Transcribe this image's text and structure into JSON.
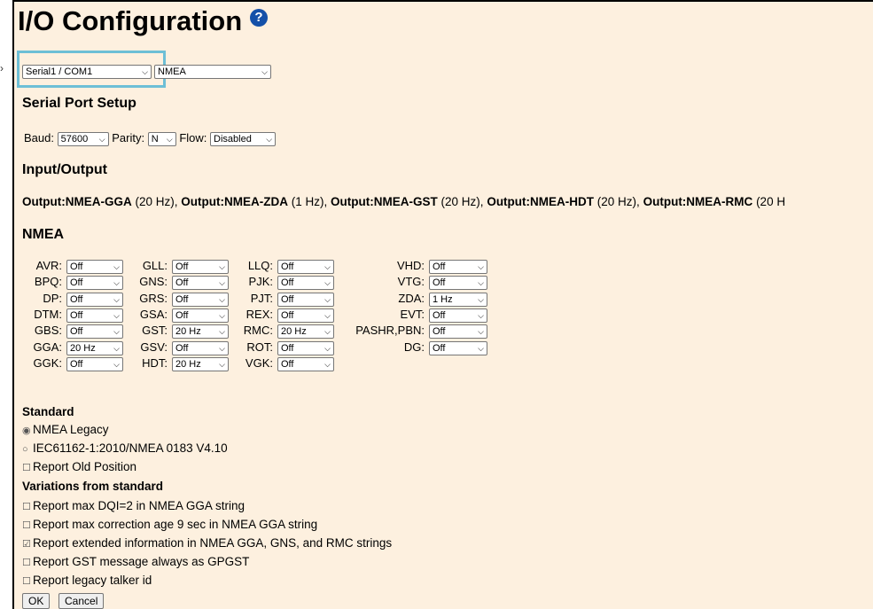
{
  "page": {
    "title": "I/O Configuration"
  },
  "port": {
    "selected": "Serial1 / COM1",
    "protocol": "NMEA"
  },
  "serial": {
    "heading": "Serial Port Setup",
    "baud_label": "Baud:",
    "baud_value": "57600",
    "parity_label": "Parity:",
    "parity_value": "N",
    "flow_label": "Flow:",
    "flow_value": "Disabled"
  },
  "io": {
    "heading": "Input/Output",
    "outputs": [
      {
        "name": "Output:NMEA-GGA",
        "rate": "(20 Hz),"
      },
      {
        "name": "Output:NMEA-ZDA",
        "rate": "(1 Hz),"
      },
      {
        "name": "Output:NMEA-GST",
        "rate": "(20 Hz),"
      },
      {
        "name": "Output:NMEA-HDT",
        "rate": "(20 Hz),"
      },
      {
        "name": "Output:NMEA-RMC",
        "rate": "(20 H"
      }
    ]
  },
  "nmea": {
    "heading": "NMEA",
    "col1": [
      {
        "label": "AVR:",
        "value": "Off"
      },
      {
        "label": "BPQ:",
        "value": "Off"
      },
      {
        "label": "DP:",
        "value": "Off"
      },
      {
        "label": "DTM:",
        "value": "Off"
      },
      {
        "label": "GBS:",
        "value": "Off"
      },
      {
        "label": "GGA:",
        "value": "20 Hz"
      },
      {
        "label": "GGK:",
        "value": "Off"
      }
    ],
    "col2": [
      {
        "label": "GLL:",
        "value": "Off"
      },
      {
        "label": "GNS:",
        "value": "Off"
      },
      {
        "label": "GRS:",
        "value": "Off"
      },
      {
        "label": "GSA:",
        "value": "Off"
      },
      {
        "label": "GST:",
        "value": "20 Hz"
      },
      {
        "label": "GSV:",
        "value": "Off"
      },
      {
        "label": "HDT:",
        "value": "20 Hz"
      }
    ],
    "col3": [
      {
        "label": "LLQ:",
        "value": "Off"
      },
      {
        "label": "PJK:",
        "value": "Off"
      },
      {
        "label": "PJT:",
        "value": "Off"
      },
      {
        "label": "REX:",
        "value": "Off"
      },
      {
        "label": "RMC:",
        "value": "20 Hz"
      },
      {
        "label": "ROT:",
        "value": "Off"
      },
      {
        "label": "VGK:",
        "value": "Off"
      }
    ],
    "col4": [
      {
        "label": "VHD:",
        "value": "Off"
      },
      {
        "label": "VTG:",
        "value": "Off"
      },
      {
        "label": "ZDA:",
        "value": "1 Hz"
      },
      {
        "label": "EVT:",
        "value": "Off"
      },
      {
        "label": "PASHR,PBN:",
        "value": "Off"
      },
      {
        "label": "DG:",
        "value": "Off"
      }
    ]
  },
  "standard": {
    "heading": "Standard",
    "options": [
      {
        "label": "NMEA Legacy",
        "type": "radio",
        "checked": true
      },
      {
        "label": "IEC61162-1:2010/NMEA 0183 V4.10",
        "type": "radio",
        "checked": false
      },
      {
        "label": "Report Old Position",
        "type": "checkbox",
        "checked": false
      }
    ]
  },
  "variations": {
    "heading": "Variations from standard",
    "options": [
      {
        "label": "Report max DQI=2 in NMEA GGA string",
        "checked": false
      },
      {
        "label": "Report max correction age 9 sec in NMEA GGA string",
        "checked": false
      },
      {
        "label": "Report extended information in NMEA GGA, GNS, and RMC strings",
        "checked": true
      },
      {
        "label": "Report GST message always as GPGST",
        "checked": false
      },
      {
        "label": "Report legacy talker id",
        "checked": false
      }
    ]
  },
  "buttons": {
    "ok": "OK",
    "cancel": "Cancel"
  }
}
